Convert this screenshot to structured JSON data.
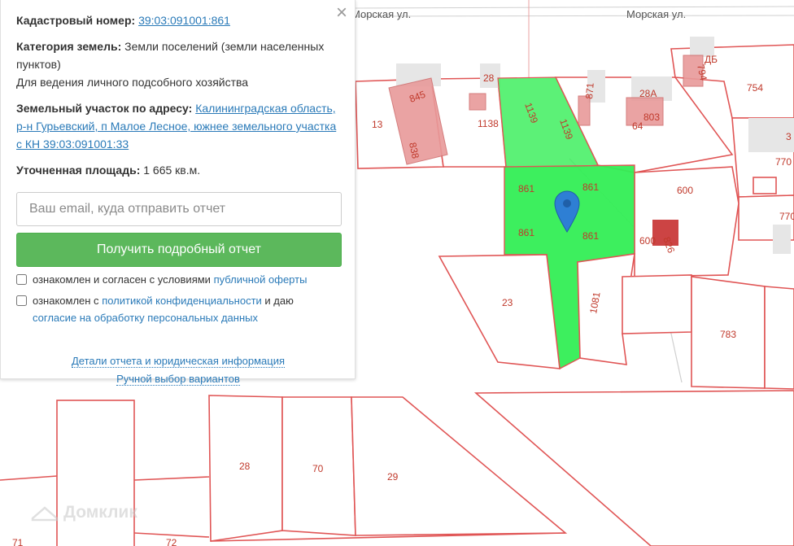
{
  "panel": {
    "close_icon": "×",
    "cadastral": {
      "label": "Кадастровый номер:",
      "value": "39:03:091001:861"
    },
    "category": {
      "label": "Категория земель:",
      "value": "Земли поселений (земли населенных пунктов)",
      "usage": "Для ведения личного подсобного хозяйства"
    },
    "address": {
      "label": "Земельный участок по адресу:",
      "value": "Калининградская область, р-н Гурьевский, п Малое Лесное, южнее земельного участка с КН 39:03:091001:33"
    },
    "area": {
      "label": "Уточненная площадь:",
      "value": "1 665 кв.м."
    },
    "email_placeholder": "Ваш email, куда отправить отчет",
    "submit_label": "Получить подробный отчет",
    "consent1": {
      "text": "ознакомлен и согласен с условиями ",
      "link": "публичной оферты"
    },
    "consent2": {
      "text1": "ознакомлен с ",
      "link1": "политикой конфиденциальности",
      "text2": " и даю ",
      "link2": "согласие на обработку персональных данных"
    },
    "details_link": "Детали отчета и юридическая информация",
    "manual_link": "Ручной выбор вариантов"
  },
  "map": {
    "streets": [
      "Морская ул.",
      "Морская ул."
    ],
    "parcel_labels": [
      "754",
      "794",
      "ДБ",
      "28А",
      "871",
      "803",
      "64",
      "28",
      "845",
      "838",
      "13",
      "1138",
      "1139",
      "1139",
      "600",
      "600",
      "826",
      "770",
      "770",
      "3",
      "861",
      "861",
      "861",
      "861",
      "23",
      "1081",
      "783",
      "28",
      "70",
      "29",
      "71",
      "72"
    ],
    "watermark": "Домклик",
    "colors": {
      "selected": "#33ee55",
      "boundary": "#e05555",
      "marker": "#2e7fd4"
    }
  }
}
